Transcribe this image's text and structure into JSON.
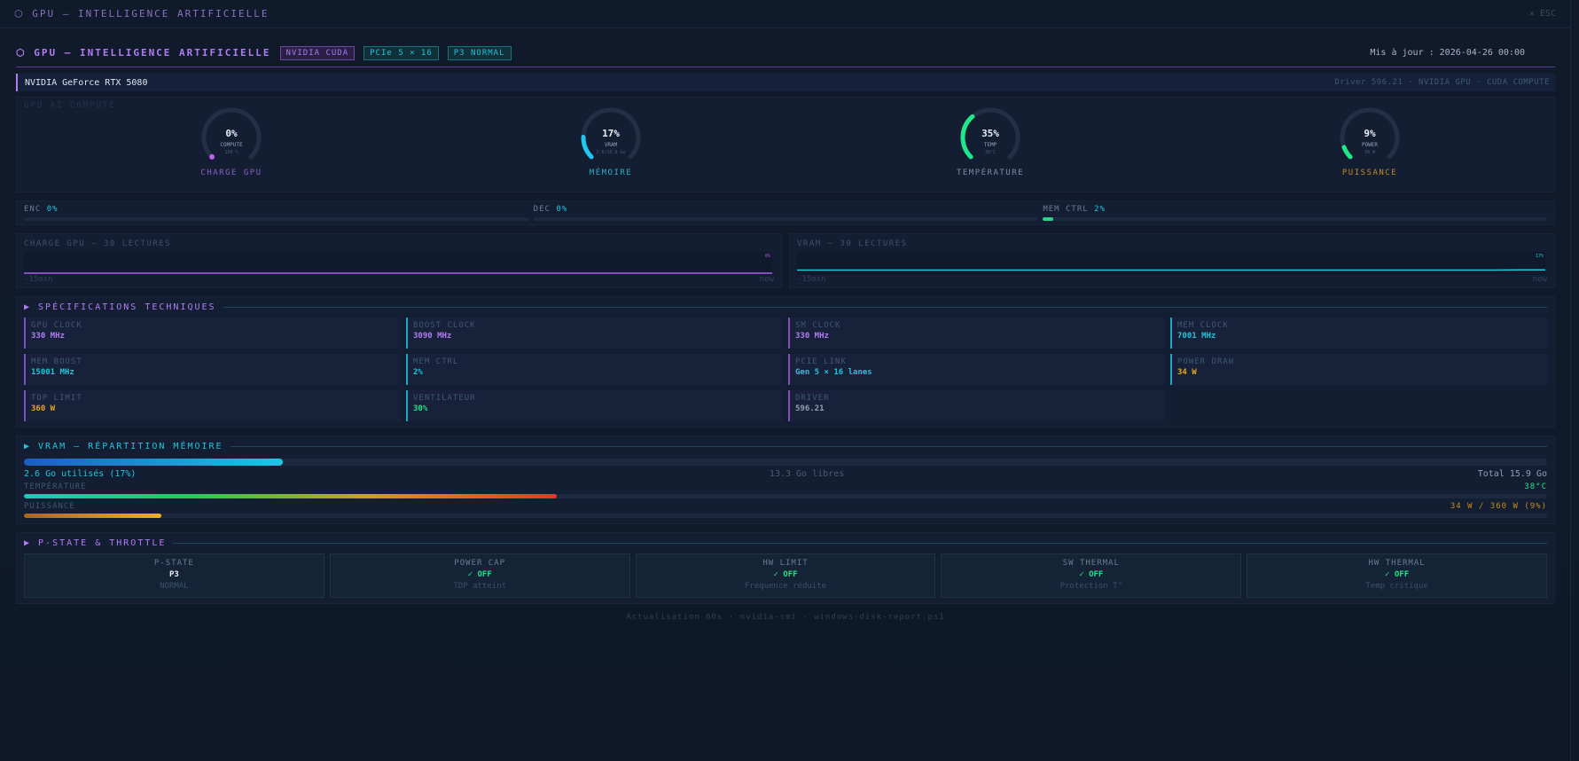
{
  "window": {
    "title": "⬡ GPU — INTELLIGENCE ARTIFICIELLE",
    "close_label": "✕ ESC"
  },
  "header": {
    "title": "⬡ GPU — INTELLIGENCE ARTIFICIELLE",
    "badges": [
      "NVIDIA CUDA",
      "PCIe 5 × 16",
      "P3 NORMAL"
    ],
    "updated": "Mis à jour : 2026-04-26 00:00"
  },
  "device": {
    "name": "NVIDIA GeForce RTX 5080",
    "driver_info": "Driver 596.21 · NVIDIA GPU · CUDA COMPUTE"
  },
  "gauges": {
    "section_label": "GPU AI COMPUTE",
    "items": [
      {
        "value": "0%",
        "sub": "COMPUTE",
        "detail": "100 %",
        "name": "CHARGE GPU",
        "fraction": 0.0,
        "color": "#c060f0",
        "name_color": "#8a5fc4"
      },
      {
        "value": "17%",
        "sub": "VRAM",
        "detail": "2.6/15.9 Go",
        "name": "MÉMOIRE",
        "fraction": 0.17,
        "color": "#1ec8f0",
        "name_color": "#2ab0c8"
      },
      {
        "value": "35%",
        "sub": "TEMP",
        "detail": "38°C",
        "name": "TEMPÉRATURE",
        "fraction": 0.35,
        "color": "#1ee88a",
        "name_color": "#7c8ea2"
      },
      {
        "value": "9%",
        "sub": "POWER",
        "detail": "34 W",
        "name": "PUISSANCE",
        "fraction": 0.09,
        "color": "#1ee88a",
        "name_color": "#c48a1e"
      }
    ]
  },
  "small_bars": [
    {
      "label": "ENC",
      "value": "0%",
      "fraction": 0.0
    },
    {
      "label": "DEC",
      "value": "0%",
      "fraction": 0.0
    },
    {
      "label": "MEM CTRL",
      "value": "2%",
      "fraction": 0.02
    }
  ],
  "sparks": [
    {
      "title": "CHARGE GPU — 30 LECTURES",
      "start": "-15min",
      "end": "now",
      "last": "0%",
      "color": "#b15ef0",
      "values": [
        0,
        0,
        0,
        0,
        0,
        0,
        0,
        0,
        0,
        0,
        0,
        0,
        0,
        0,
        0,
        0,
        0,
        0,
        0,
        0,
        0,
        0,
        0,
        0,
        0,
        0,
        0,
        0,
        0,
        0
      ]
    },
    {
      "title": "VRAM — 30 LECTURES",
      "start": "-15min",
      "end": "now",
      "last": "17%",
      "color": "#1ec8d8",
      "values": [
        16,
        16,
        16,
        16,
        16,
        16,
        16,
        16,
        16,
        16,
        16,
        16,
        16,
        16,
        16,
        16,
        16,
        16,
        16,
        16,
        16,
        16,
        16,
        16,
        16,
        16,
        16,
        16,
        17,
        17
      ]
    }
  ],
  "specs": {
    "title": "▶ SPÉCIFICATIONS TECHNIQUES",
    "items": [
      {
        "key": "GPU CLOCK",
        "value": "330 MHz",
        "color": "#b17cf2"
      },
      {
        "key": "BOOST CLOCK",
        "value": "3090 MHz",
        "color": "#b17cf2"
      },
      {
        "key": "SM CLOCK",
        "value": "330 MHz",
        "color": "#b17cf2"
      },
      {
        "key": "MEM CLOCK",
        "value": "7001 MHz",
        "color": "#22c4d8"
      },
      {
        "key": "MEM BOOST",
        "value": "15001 MHz",
        "color": "#22c4d8"
      },
      {
        "key": "MEM CTRL",
        "value": "2%",
        "color": "#22c4d8"
      },
      {
        "key": "PCIE LINK",
        "value": "Gen 5 × 16 lanes",
        "color": "#22c4d8"
      },
      {
        "key": "POWER DRAW",
        "value": "34 W",
        "color": "#e8a51e"
      },
      {
        "key": "TDP LIMIT",
        "value": "360 W",
        "color": "#e8a51e"
      },
      {
        "key": "VENTILATEUR",
        "value": "30%",
        "color": "#27e08a"
      },
      {
        "key": "DRIVER",
        "value": "596.21",
        "color": "#8fa0b6"
      }
    ]
  },
  "vram": {
    "title": "▶ VRAM — RÉPARTITION MÉMOIRE",
    "used": "2.6 Go utilisés (17%)",
    "free": "13.3 Go libres",
    "total": "Total 15.9 Go",
    "fraction": 0.17,
    "temp_label": "TEMPÉRATURE",
    "temp_value": "38°C",
    "temp_fraction": 0.35,
    "power_label": "PUISSANCE",
    "power_value": "34 W / 360 W (9%)",
    "power_fraction": 0.09
  },
  "pstate": {
    "title": "▶ P-STATE & THROTTLE",
    "cells": [
      {
        "key": "P-STATE",
        "value": "P3",
        "sub": "NORMAL"
      },
      {
        "key": "POWER CAP",
        "value": "✓ OFF",
        "sub": "TDP atteint"
      },
      {
        "key": "HW LIMIT",
        "value": "✓ OFF",
        "sub": "Fréquence réduite"
      },
      {
        "key": "SW THERMAL",
        "value": "✓ OFF",
        "sub": "Protection T°"
      },
      {
        "key": "HW THERMAL",
        "value": "✓ OFF",
        "sub": "Temp critique"
      }
    ]
  },
  "footer": "Actualisation 60s · nvidia-smi · windows-disk-report.ps1"
}
